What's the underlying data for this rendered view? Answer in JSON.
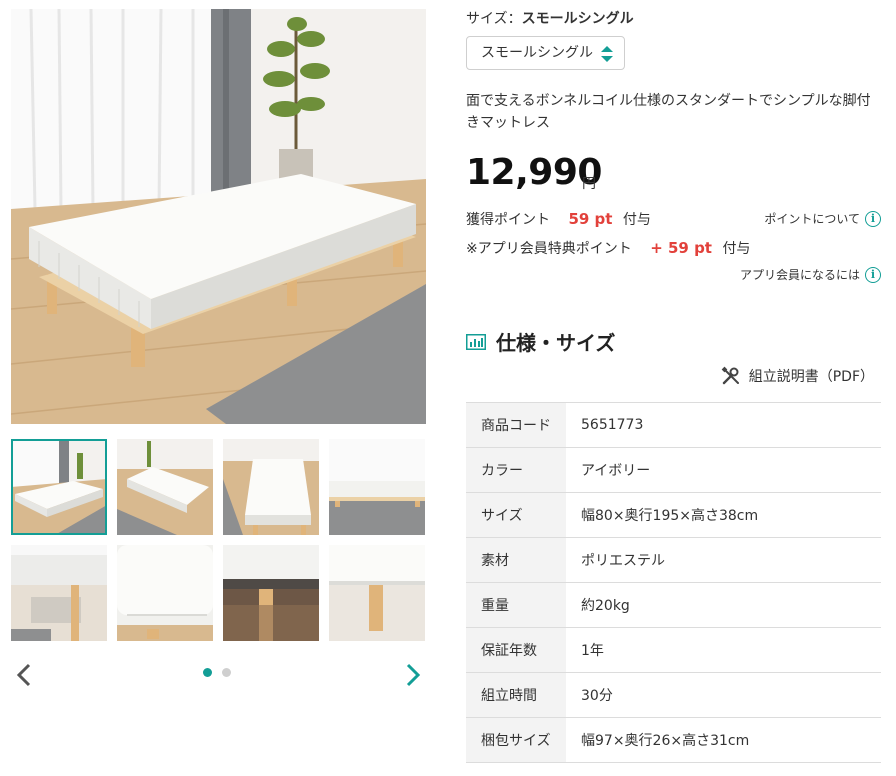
{
  "options": {
    "size_label": "サイズ：",
    "size_value": "スモールシングル",
    "select_value": "スモールシングル"
  },
  "product": {
    "description": "面で支えるボンネルコイル仕様のスタンダートでシンプルな脚付きマットレス",
    "price": "12,990",
    "price_unit": "円"
  },
  "points": {
    "label": "獲得ポイント",
    "value": "59 pt",
    "suffix": "付与",
    "about_link": "ポイントについて",
    "app_label": "※アプリ会員特典ポイント",
    "app_value": "+ 59 pt",
    "app_suffix": "付与",
    "app_link": "アプリ会員になるには"
  },
  "spec": {
    "heading": "仕様・サイズ",
    "manual_link": "組立説明書（PDF）",
    "rows": [
      {
        "key": "商品コード",
        "value": "5651773"
      },
      {
        "key": "カラー",
        "value": "アイボリー"
      },
      {
        "key": "サイズ",
        "value": "幅80×奥行195×高さ38cm"
      },
      {
        "key": "素材",
        "value": "ポリエステル"
      },
      {
        "key": "重量",
        "value": "約20kg"
      },
      {
        "key": "保証年数",
        "value": "1年"
      },
      {
        "key": "組立時間",
        "value": "30分"
      },
      {
        "key": "梱包サイズ",
        "value": "幅97×奥行26×高さ31cm"
      }
    ]
  },
  "gallery": {
    "thumb_count": 8,
    "active_thumb": 1,
    "page_dots": 2,
    "active_dot": 1
  },
  "icons": {
    "accent": "#139e96",
    "point_red": "#e2413b",
    "spec_icon": "chart-table-icon",
    "info_icon": "info-icon",
    "manual_icon": "tools-icon"
  }
}
